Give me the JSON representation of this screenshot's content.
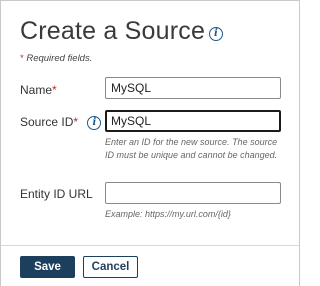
{
  "dialog": {
    "title": "Create a Source",
    "title_icon": "info-icon",
    "required_star": "*",
    "required_note": "Required fields."
  },
  "fields": {
    "name": {
      "label": "Name",
      "required_star": "*",
      "value": "MySQL"
    },
    "source_id": {
      "label": "Source ID",
      "required_star": "*",
      "icon": "info-icon",
      "value": "MySQL",
      "help": "Enter an ID for the new source. The source ID must be unique and cannot be changed."
    },
    "entity_id_url": {
      "label": "Entity ID URL",
      "value": "",
      "help": "Example: https://my.url.com/{id}"
    }
  },
  "footer": {
    "save_label": "Save",
    "cancel_label": "Cancel"
  },
  "colors": {
    "primary": "#1d3f5e",
    "required": "#c4282d",
    "info_icon": "#1c5a8c"
  }
}
